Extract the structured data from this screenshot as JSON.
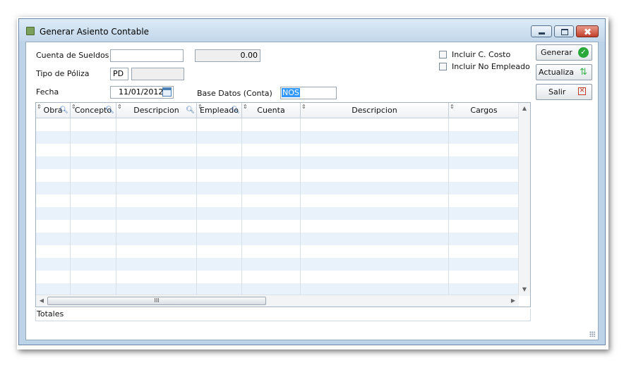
{
  "window": {
    "title": "Generar Asiento Contable"
  },
  "form": {
    "cuenta_sueldos": {
      "label": "Cuenta de Sueldos",
      "value": "",
      "amount": "0.00"
    },
    "tipo_poliza": {
      "label": "Tipo de Póliza",
      "code": "PD",
      "description": ""
    },
    "fecha": {
      "label": "Fecha",
      "value": "11/01/2012"
    },
    "base_datos": {
      "label": "Base Datos (Conta)",
      "value": "NOS"
    }
  },
  "options": {
    "incluir_c_costo": {
      "label": "Incluir C. Costo",
      "checked": false
    },
    "incluir_no_empleado": {
      "label": "Incluir No Empleado",
      "checked": false
    }
  },
  "buttons": {
    "generar": "Generar",
    "actualiza": "Actualiza",
    "salir": "Salir"
  },
  "grid": {
    "columns": [
      "Obra",
      "Concepto",
      "Descripcion",
      "Empleado",
      "Cuenta",
      "Descripcion",
      "Cargos"
    ],
    "rows": [],
    "scroll_thumb_label": "III"
  },
  "totals": {
    "label": "Totales"
  },
  "icons": {
    "title": "app-window-icon",
    "generar": "check-circle-icon",
    "actualiza": "refresh-arrows-icon",
    "salir": "close-x-icon",
    "fecha": "calendar-icon",
    "search": "magnifier-icon"
  },
  "colors": {
    "window_frame": "#bcd3e8",
    "grid_alt_row": "#e9f2fb",
    "selection": "#3399ff",
    "ok_green": "#2aa83a",
    "close_red": "#c0392b"
  }
}
